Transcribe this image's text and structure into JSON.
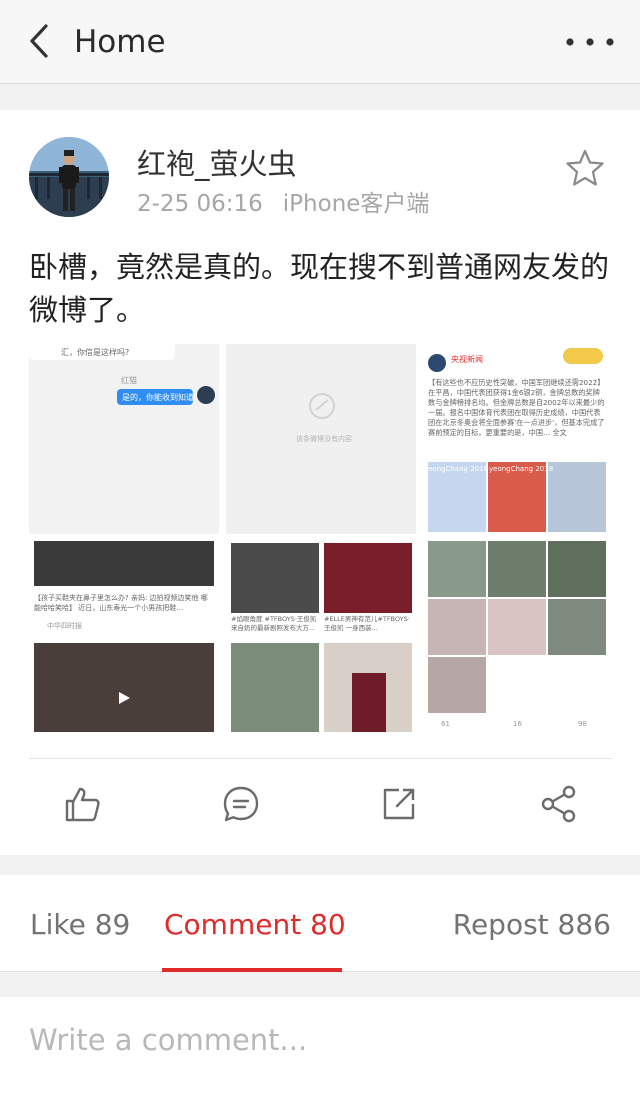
{
  "nav": {
    "title": "Home",
    "back_icon": "chevron-left-icon",
    "more_icon": "more-dots-icon"
  },
  "post": {
    "username": "红袍_萤火虫",
    "time": "2-25 06:16",
    "source": "iPhone客户端",
    "text": "卧槽，竟然是真的。现在搜不到普通网友发的微博了。"
  },
  "thumbs": {
    "chat_q": "汇，你信是这样吗?",
    "chat_name": "红猫",
    "chat_reply": "是的，你能收到知道",
    "blank_caption": "该条微博没有内容",
    "news_account": "央视新闻",
    "news_text": "【有这些也不应历史性突破，中国军团继续还需2022】在平昌，中国代表团获得1金6银2铜，金牌总数的奖牌数与金牌榜排名均。但金牌总数是自2002年以来最少的一届。报名中国体育代表团在取得历史成绩，中国代表团在北京冬奥会将全面参赛'在一点进步'，但基本完成了赛前预定的目标。更重要的是，中国… 全文",
    "olympic_banner": "eongChang 2018",
    "olympic_banner2": "yeongChang 2018",
    "kid_caption": "【孩子买鞋夹在鼻子里怎么办? 亲妈: 边拍视频边笑他 哪能哈哈笑哈】 近日，山东寿光一个小男孩把鞋…",
    "kid_source": "中华四时报",
    "tfboys_caption": "#焰眼角度 #TFBOYS·王俊凯 来自奶的最新剧照发布大方...",
    "tfboys_caption2": "#ELLE男神有范儿#TFBOYS·王俊凯 一身西装...",
    "repost_count": "61",
    "comment_count": "16",
    "like_count": "98"
  },
  "tabs": {
    "like_label": "Like 89",
    "comment_label": "Comment 80",
    "repost_label": "Repost 886"
  },
  "composer": {
    "placeholder": "Write a comment..."
  },
  "colors": {
    "accent": "#e02b2b",
    "chat_bubble": "#2f8cf0"
  }
}
